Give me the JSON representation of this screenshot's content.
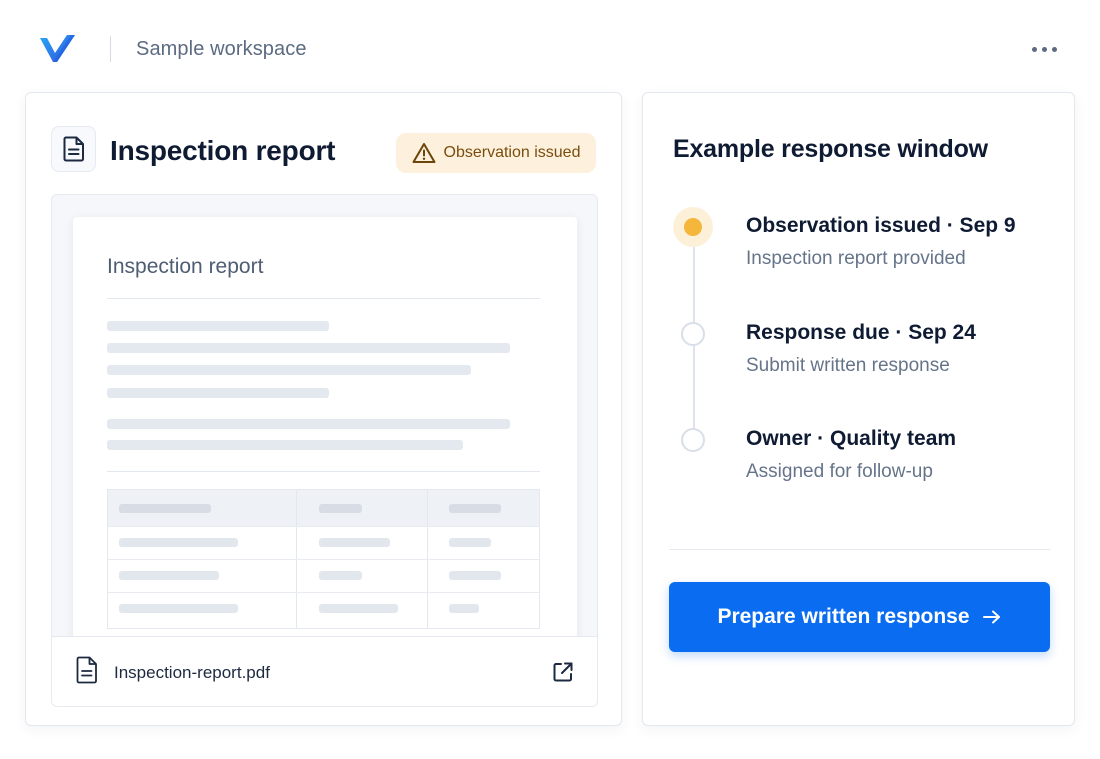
{
  "header": {
    "logo": "brand-v-logo",
    "workspace_name": "Sample workspace",
    "more_icon": "more-horizontal-icon"
  },
  "report_card": {
    "title": "Inspection report",
    "icon": "document-icon",
    "status_badge": {
      "label": "Observation issued",
      "icon": "warning-triangle-icon",
      "background": "#fdf1dd",
      "text_color": "#7a4d0d"
    },
    "preview": {
      "document_title": "Inspection report"
    },
    "attachment": {
      "file_name": "Inspection-report.pdf",
      "icon": "file-icon",
      "action_icon": "external-link-icon"
    }
  },
  "response_card": {
    "title": "Example response window",
    "timeline": [
      {
        "heading": "Observation issued · Sep 9",
        "subtitle": "Inspection report provided",
        "state": "active"
      },
      {
        "heading": "Response due · Sep 24",
        "subtitle": "Submit written response",
        "state": "pending"
      },
      {
        "heading": "Owner · Quality team",
        "subtitle": "Assigned for follow-up",
        "state": "pending"
      }
    ],
    "primary_action": {
      "label": "Prepare written response",
      "icon": "arrow-right-icon",
      "color": "#0a6cf0"
    }
  },
  "colors": {
    "accent": "#0a6cf0",
    "active_marker": "#f5b63c",
    "brand_gradient_start": "#1a8cf5",
    "brand_gradient_end": "#2f4fd8"
  }
}
